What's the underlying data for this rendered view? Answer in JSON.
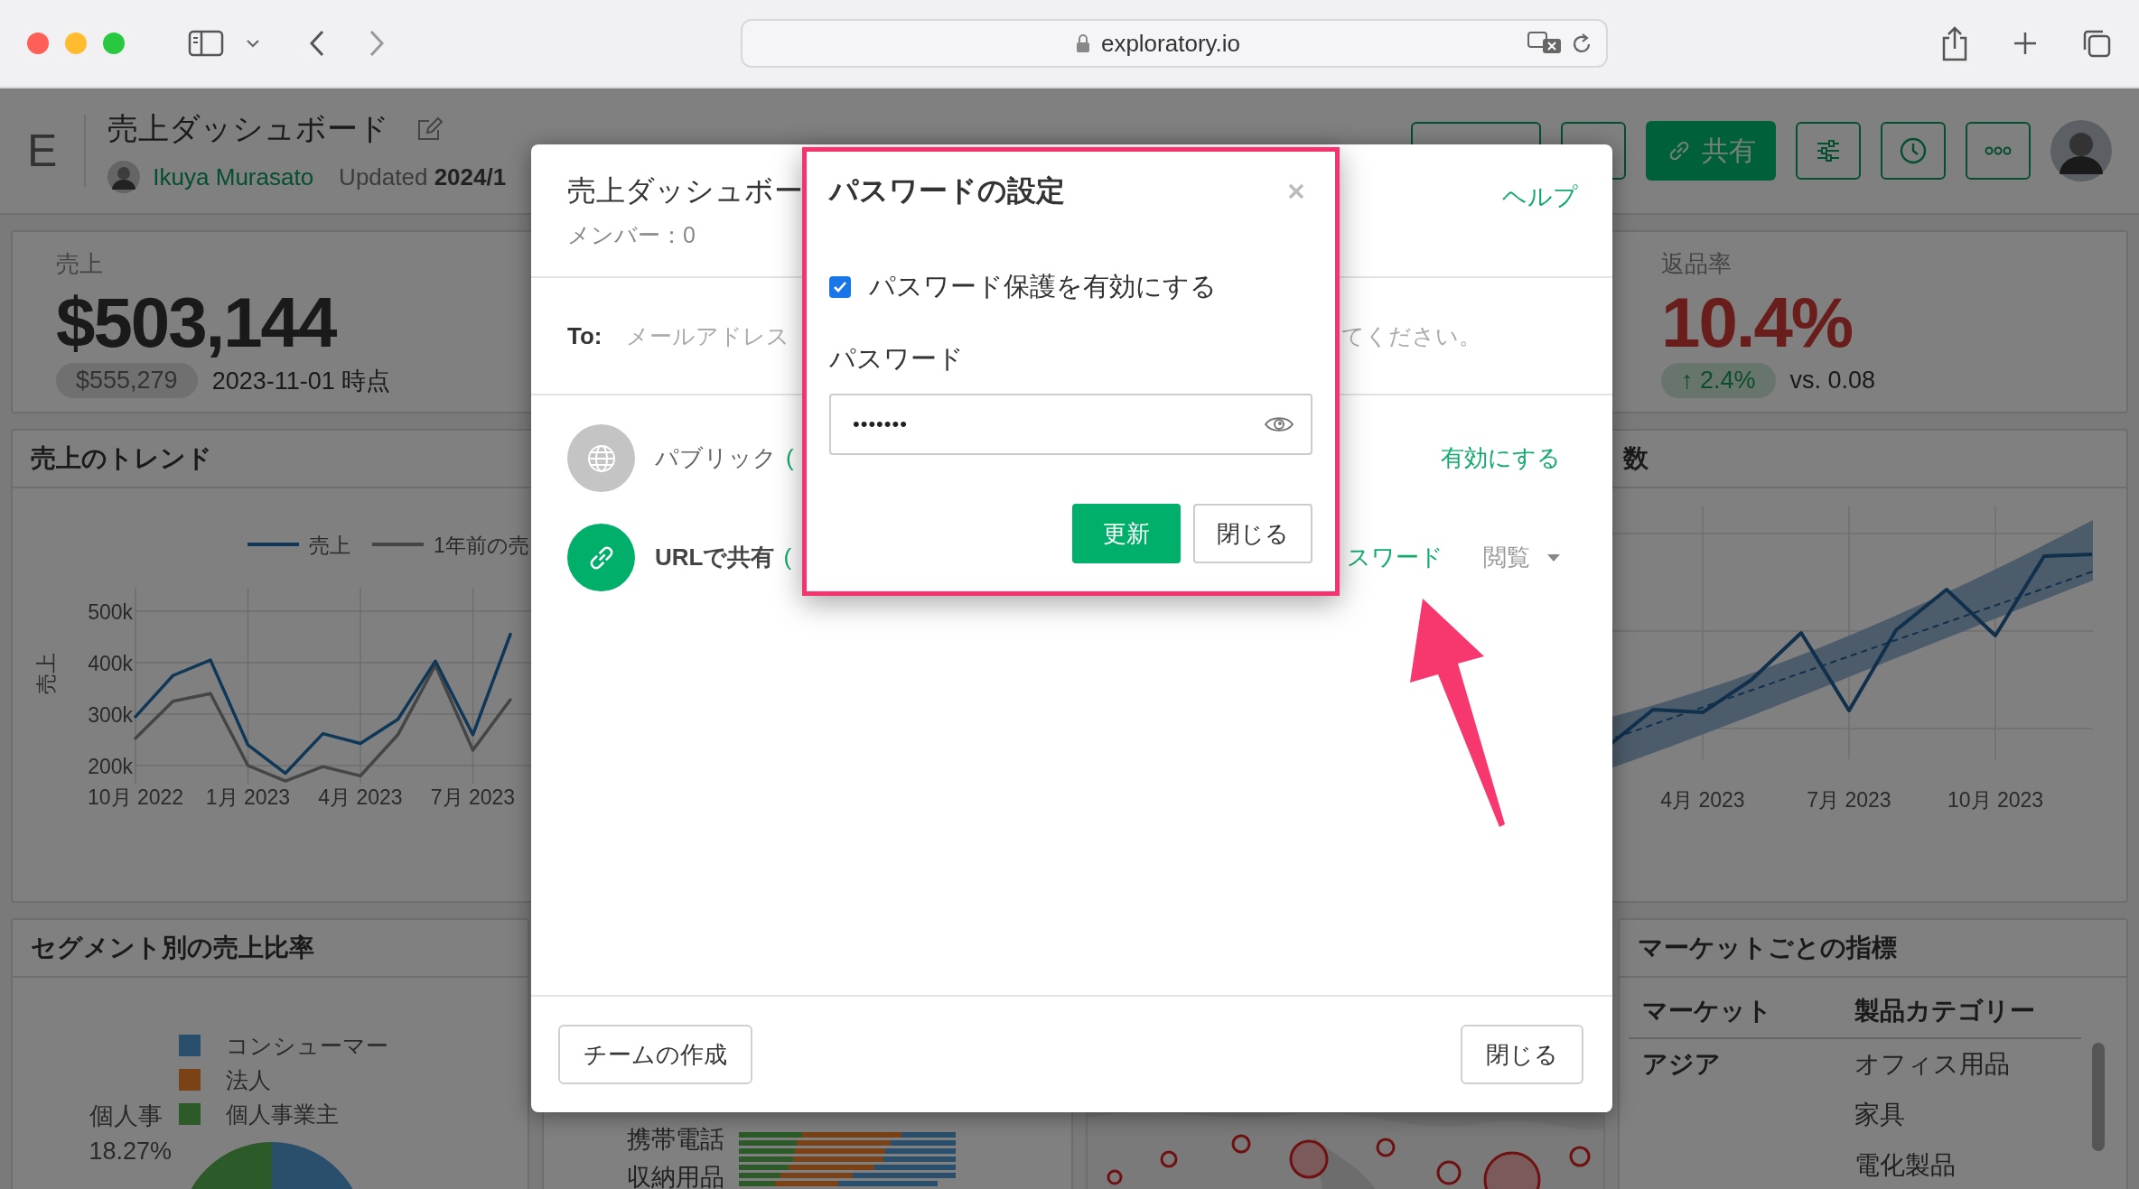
{
  "browser": {
    "url": "exploratory.io"
  },
  "header": {
    "logo": "E",
    "title": "売上ダッシュボード",
    "author": "Ikuya Murasato",
    "updated": "Updated **2024/1**",
    "share_button": "共有"
  },
  "kpis": [
    {
      "kind": "plain",
      "label": "売上",
      "value": "$503,144",
      "badge": "$555,279",
      "note": "2023-11-01 時点"
    },
    {
      "kind": "alert",
      "label": "返品率",
      "value": "10.4%",
      "badge": "↑ 2.4%",
      "note": "vs. 0.08"
    }
  ],
  "trend_panel": {
    "title": "売上のトレンド",
    "chart_data": {
      "type": "line",
      "ylabel": "売上",
      "categories": [
        "10月 2022",
        null,
        null,
        "1月 2023",
        null,
        null,
        "4月 2023",
        null,
        null,
        "7月 2023",
        null,
        null
      ],
      "series": [
        {
          "name": "売上",
          "color": "#0f3858",
          "values": [
            295000,
            375000,
            405000,
            240000,
            185000,
            262000,
            243000,
            290000,
            403000,
            260000,
            455000,
            null
          ]
        },
        {
          "name": "1年前の売",
          "color": "#454545",
          "values": [
            253000,
            325000,
            340000,
            200000,
            170000,
            198000,
            180000,
            260000,
            395000,
            230000,
            328000,
            null
          ]
        }
      ],
      "yticks": [
        {
          "value": 200000,
          "label": "200k"
        },
        {
          "value": 300000,
          "label": "300k"
        },
        {
          "value": 400000,
          "label": "400k"
        },
        {
          "value": 500000,
          "label": "500k"
        }
      ],
      "ylim": [
        165000,
        545000
      ],
      "grid": true,
      "legend": "top"
    }
  },
  "forecast_panel": {
    "title": "数",
    "x_labels": [
      "4月 2023",
      "7月 2023",
      "10月 2023"
    ]
  },
  "segment_panel": {
    "title": "セグメント別の売上比率",
    "legend": [
      {
        "label": "コンシューマー",
        "color": "#2a4f6c"
      },
      {
        "label": "法人",
        "color": "#7a4216"
      },
      {
        "label": "個人事業主",
        "color": "#2c5a28"
      }
    ],
    "slice_label": "個人事",
    "slice_value": "18.27%"
  },
  "category_panel": {
    "labels": [
      "携帯電話",
      "収納用品"
    ]
  },
  "market_panel": {
    "title": "マーケットごとの指標",
    "columns": [
      "マーケット",
      "製品カテゴリー"
    ],
    "rows": [
      {
        "market": "アジア",
        "category": "オフィス用品"
      },
      {
        "category": "家具"
      },
      {
        "category": "電化製品"
      }
    ]
  },
  "share_dialog": {
    "title": "売上ダッシュボー",
    "members": "メンバー：0",
    "help": "ヘルプ",
    "to_label": "To:",
    "placeholder_parts": [
      "メールアドレス",
      "てください。"
    ],
    "options": [
      {
        "kind": "public",
        "label": "パブリック",
        "paren": "(",
        "enabled": false,
        "action": "有効にする"
      },
      {
        "kind": "url",
        "label": "URLで共有",
        "paren": "(",
        "enabled": true,
        "action": "スワード",
        "permission": "閲覧"
      }
    ],
    "footer_buttons": [
      "チームの作成",
      "閉じる"
    ]
  },
  "password_dialog": {
    "title": "パスワードの設定",
    "protect": {
      "label": "パスワード保護を有効にする",
      "checked": true
    },
    "field_label": "パスワード",
    "value": "•••••••",
    "buttons": [
      {
        "kind": "primary",
        "label": "更新"
      },
      {
        "kind": "secondary",
        "label": "閉じる"
      }
    ]
  }
}
